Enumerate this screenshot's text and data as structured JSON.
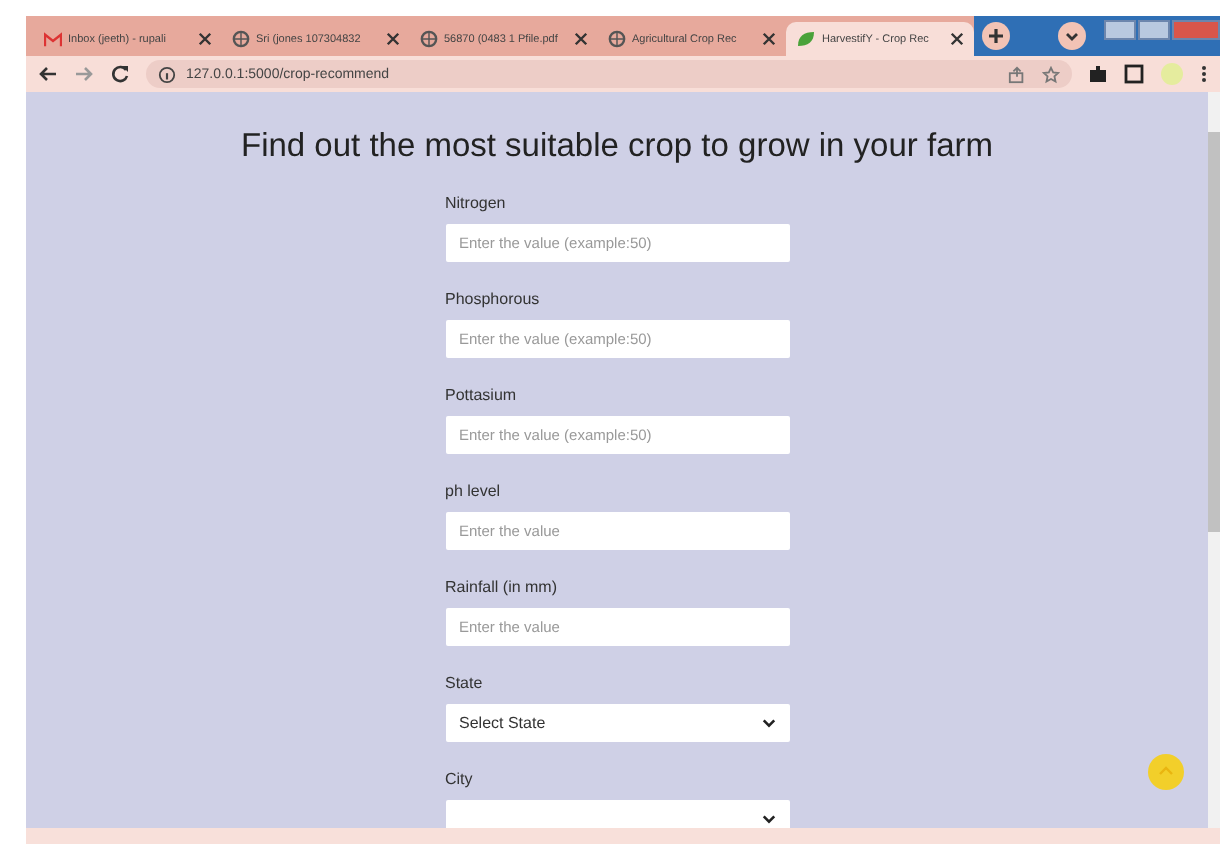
{
  "tabs": [
    {
      "title": "Inbox (jeeth) - rupali",
      "selected": false
    },
    {
      "title": "Sri (jones 107304832",
      "selected": false
    },
    {
      "title": "56870 (0483 1 Pfile.pdf",
      "selected": false
    },
    {
      "title": "Agricultural Crop Rec",
      "selected": false
    },
    {
      "title": "HarvestifY - Crop Rec",
      "selected": true
    }
  ],
  "address": {
    "url": "127.0.0.1:5000/crop-recommend"
  },
  "page": {
    "heading": "Find out the most suitable crop to grow in your farm",
    "fields": [
      {
        "label": "Nitrogen",
        "kind": "input",
        "placeholder": "Enter the value (example:50)"
      },
      {
        "label": "Phosphorous",
        "kind": "input",
        "placeholder": "Enter the value (example:50)"
      },
      {
        "label": "Pottasium",
        "kind": "input",
        "placeholder": "Enter the value (example:50)"
      },
      {
        "label": "ph level",
        "kind": "input",
        "placeholder": "Enter the value"
      },
      {
        "label": "Rainfall (in mm)",
        "kind": "input",
        "placeholder": "Enter the value"
      },
      {
        "label": "State",
        "kind": "select",
        "value": "Select State"
      },
      {
        "label": "City",
        "kind": "select"
      }
    ]
  }
}
